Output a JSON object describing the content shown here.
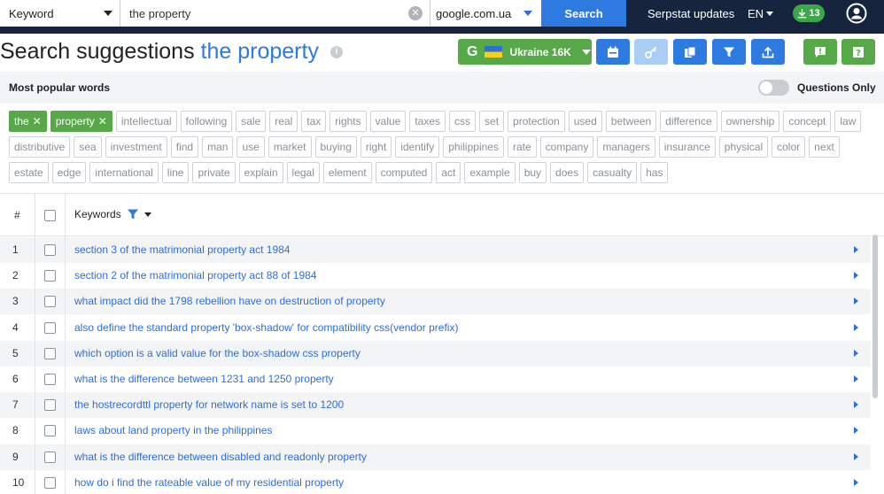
{
  "topbar": {
    "search_type": "Keyword",
    "query": "the property",
    "database": "google.com.ua",
    "search_label": "Search",
    "updates_label": "Serpstat updates",
    "language": "EN",
    "downloads_count": "13",
    "icons": [
      "caret-down-icon",
      "clear-icon",
      "download-icon",
      "user-icon"
    ]
  },
  "header": {
    "title_prefix": "Search suggestions",
    "title_query": "the property",
    "info_glyph": "i",
    "region_g": "G",
    "region_label": "Ukraine 16K",
    "colors": {
      "accent_blue": "#2d7be0",
      "accent_green": "#56a849",
      "topbar_bg": "#16253d"
    }
  },
  "popular": {
    "label": "Most popular words",
    "questions_only": "Questions Only",
    "active_words": [
      "the",
      "property"
    ],
    "words": [
      "intellectual",
      "following",
      "sale",
      "real",
      "tax",
      "rights",
      "value",
      "taxes",
      "css",
      "set",
      "protection",
      "used",
      "between",
      "difference",
      "ownership",
      "concept",
      "law",
      "distributive",
      "sea",
      "investment",
      "find",
      "man",
      "use",
      "market",
      "buying",
      "right",
      "identify",
      "philippines",
      "rate",
      "company",
      "managers",
      "insurance",
      "physical",
      "color",
      "next",
      "estate",
      "edge",
      "international",
      "line",
      "private",
      "explain",
      "legal",
      "element",
      "computed",
      "act",
      "example",
      "buy",
      "does",
      "casualty",
      "has"
    ]
  },
  "table": {
    "col_num": "#",
    "col_keywords": "Keywords",
    "rows": [
      {
        "n": "1",
        "kw": "section 3 of the matrimonial property act 1984"
      },
      {
        "n": "2",
        "kw": "section 2 of the matrimonial property act 88 of 1984"
      },
      {
        "n": "3",
        "kw": "what impact did the 1798 rebellion have on destruction of property"
      },
      {
        "n": "4",
        "kw": "also define the standard property 'box-shadow' for compatibility css(vendor prefix)"
      },
      {
        "n": "5",
        "kw": "which option is a valid value for the box-shadow css property"
      },
      {
        "n": "6",
        "kw": "what is the difference between 1231 and 1250 property"
      },
      {
        "n": "7",
        "kw": "the hostrecordttl property for network name is set to 1200"
      },
      {
        "n": "8",
        "kw": "laws about land property in the philippines"
      },
      {
        "n": "9",
        "kw": "what is the difference between disabled and readonly property"
      },
      {
        "n": "10",
        "kw": "how do i find the rateable value of my residential property"
      }
    ]
  }
}
